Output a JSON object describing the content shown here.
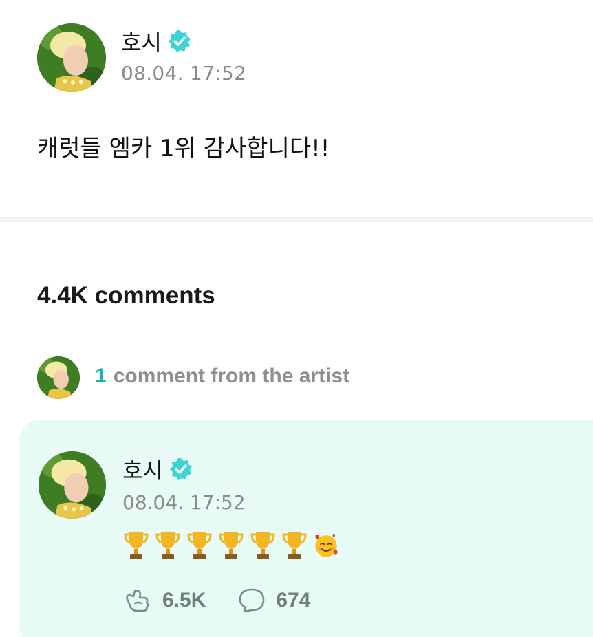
{
  "post": {
    "author": "호시",
    "timestamp": "08.04. 17:52",
    "body": "캐럿들 엠카 1위 감사합니다!!"
  },
  "comments_section": {
    "count_label": "4.4K comments",
    "artist_comment_count": "1",
    "artist_comment_label": "comment from the artist"
  },
  "comment": {
    "author": "호시",
    "timestamp": "08.04. 17:52",
    "body_emojis": [
      "trophy-emoji",
      "trophy-emoji",
      "trophy-emoji",
      "trophy-emoji",
      "trophy-emoji",
      "trophy-emoji",
      "smiling-face-with-hearts-emoji"
    ],
    "like_count": "6.5K",
    "reply_count": "674"
  },
  "colors": {
    "accent_teal": "#19b5b0",
    "verified_badge": "#3fd3d6",
    "card_background": "#e8fbf6",
    "muted_text": "#8a8a8a"
  }
}
